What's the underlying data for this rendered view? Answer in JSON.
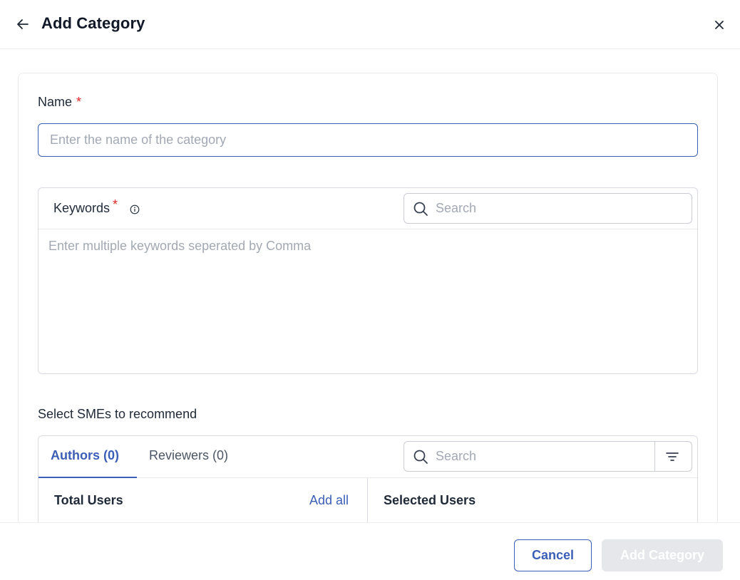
{
  "header": {
    "title": "Add Category",
    "back_icon": "arrow-left-icon",
    "close_icon": "close-icon"
  },
  "name_field": {
    "label": "Name",
    "required_mark": "*",
    "value": "",
    "placeholder": "Enter the name of the category"
  },
  "keywords": {
    "label": "Keywords",
    "required_mark": "*",
    "info_icon": "info-icon",
    "search_placeholder": "Search",
    "value": "",
    "placeholder": "Enter multiple keywords seperated by Comma"
  },
  "sme": {
    "section_label": "Select SMEs to recommend",
    "tabs": [
      {
        "label": "Authors (0)",
        "active": true
      },
      {
        "label": "Reviewers (0)",
        "active": false
      }
    ],
    "search_placeholder": "Search",
    "filter_icon": "filter-icon",
    "total_users_title": "Total Users",
    "add_all_label": "Add all",
    "selected_users_title": "Selected Users"
  },
  "footer": {
    "cancel_label": "Cancel",
    "submit_label": "Add Category",
    "submit_disabled": true
  },
  "colors": {
    "accent": "#3b5eb6",
    "required": "#dc2626",
    "placeholder": "#a3a9b3",
    "disabled_button": "#e5e7eb"
  }
}
